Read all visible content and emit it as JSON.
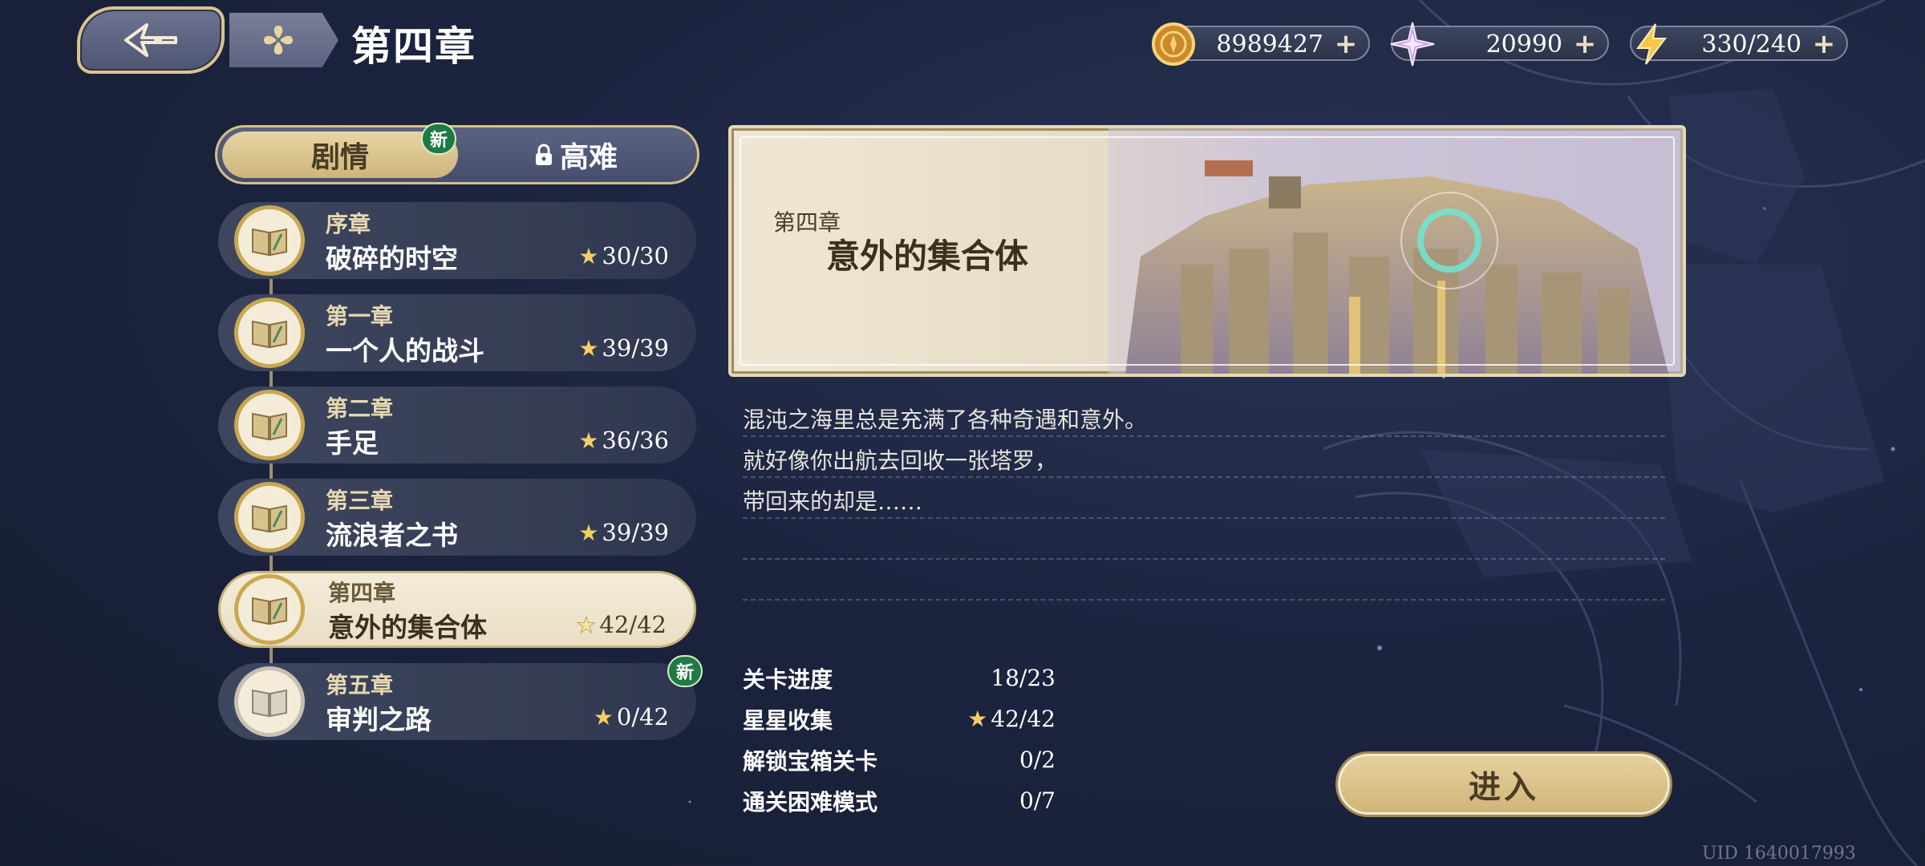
{
  "header": {
    "title": "第四章"
  },
  "currencies": [
    {
      "icon": "gold-coin-icon",
      "value": "8989427"
    },
    {
      "icon": "crystal-star-icon",
      "value": "20990"
    },
    {
      "icon": "lightning-energy-icon",
      "value": "330/240"
    }
  ],
  "tabs": {
    "story": "剧情",
    "story_badge": "新",
    "hard": "高难"
  },
  "chapters": [
    {
      "sub": "序章",
      "name": "破碎的时空",
      "stars": "30/30"
    },
    {
      "sub": "第一章",
      "name": "一个人的战斗",
      "stars": "39/39"
    },
    {
      "sub": "第二章",
      "name": "手足",
      "stars": "36/36"
    },
    {
      "sub": "第三章",
      "name": "流浪者之书",
      "stars": "39/39"
    },
    {
      "sub": "第四章",
      "name": "意外的集合体",
      "stars": "42/42"
    },
    {
      "sub": "第五章",
      "name": "审判之路",
      "stars": "0/42",
      "badge": "新"
    }
  ],
  "selected_chapter": 4,
  "banner": {
    "sub": "第四章",
    "title": "意外的集合体"
  },
  "description": [
    "混沌之海里总是充满了各种奇遇和意外。",
    "就好像你出航去回收一张塔罗，",
    "带回来的却是……",
    "",
    ""
  ],
  "stats": [
    {
      "label": "关卡进度",
      "value": "18/23"
    },
    {
      "label": "星星收集",
      "value": "42/42"
    },
    {
      "label": "解锁宝箱关卡",
      "value": "0/2"
    },
    {
      "label": "通关困难模式",
      "value": "0/7"
    }
  ],
  "enter_label": "进入",
  "uid": "UID 1640017993",
  "colors": {
    "accent_gold": "#d4c08a",
    "new_badge_green": "#1f7a45",
    "background": "#1c2440"
  }
}
